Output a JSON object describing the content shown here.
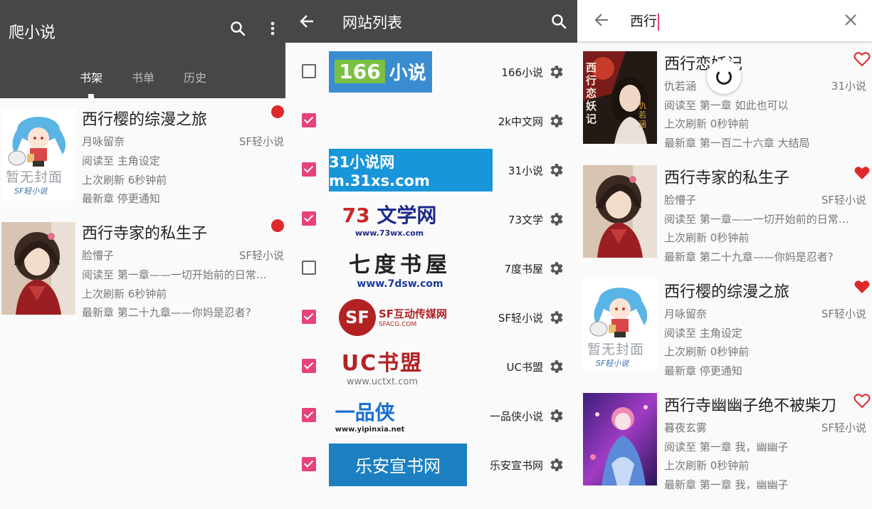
{
  "colors": {
    "appbar": "#474747",
    "accent": "#e8427a",
    "unread_dot": "#e0282a",
    "heart": "#e0282a"
  },
  "bookshelf": {
    "title": "爬小说",
    "tabs": [
      "书架",
      "书单",
      "历史"
    ],
    "active_tab": "书架",
    "books": [
      {
        "title": "西行樱的综漫之旅",
        "author": "月咏留奈",
        "source": "SF轻小说",
        "read_to": "阅读至  主角设定",
        "refresh": "上次刷新  6秒钟前",
        "latest": "最新章  停更通知",
        "cover_text": "暂无封面",
        "cover_brand": "SF轻小说"
      },
      {
        "title": "西行寺家的私生子",
        "author": "脸懵子",
        "source": "SF轻小说",
        "read_to": "阅读至  第一章——一切开始前的日常…",
        "refresh": "上次刷新  6秒钟前",
        "latest": "最新章  第二十九章——你妈是忍者?"
      }
    ]
  },
  "sites": {
    "title": "网站列表",
    "items": [
      {
        "name": "166小说",
        "checked": false,
        "logo": "166 小说"
      },
      {
        "name": "2k中文网",
        "checked": true,
        "logo": ""
      },
      {
        "name": "31小说",
        "checked": true,
        "logo": "31小说网 m.31xs.com"
      },
      {
        "name": "73文学",
        "checked": true,
        "logo": "73 文学网",
        "logo_sub": "www.73wx.com"
      },
      {
        "name": "7度书屋",
        "checked": false,
        "logo": "七度书屋",
        "logo_sub": "www.7dsw.com"
      },
      {
        "name": "SF轻小说",
        "checked": true,
        "logo": "SF互动传媒网",
        "logo_sub": "SFACG.COM"
      },
      {
        "name": "UC书盟",
        "checked": true,
        "logo": "UC书盟",
        "logo_sub": "www.uctxt.com"
      },
      {
        "name": "一品侠小说",
        "checked": true,
        "logo": "一品侠",
        "logo_sub": "www.yipinxia.net"
      },
      {
        "name": "乐安宣书网",
        "checked": true,
        "logo": "乐安宣书网"
      }
    ]
  },
  "search": {
    "query": "西行",
    "results": [
      {
        "title": "西行恋妖记",
        "author": "仇若涵",
        "source": "31小说",
        "read_to": "阅读至  第一章 如此也可以",
        "refresh": "上次刷新  0秒钟前",
        "latest": "最新章  第一百二十六章 大结局",
        "favorite": false,
        "cover_text": "西行恋妖记",
        "cover_author": "仇若涵"
      },
      {
        "title": "西行寺家的私生子",
        "author": "脸懵子",
        "source": "SF轻小说",
        "read_to": "阅读至  第一章——一切开始前的日常…",
        "refresh": "上次刷新  0秒钟前",
        "latest": "最新章  第二十九章——你妈是忍者?",
        "favorite": true
      },
      {
        "title": "西行樱的综漫之旅",
        "author": "月咏留奈",
        "source": "SF轻小说",
        "read_to": "阅读至  主角设定",
        "refresh": "上次刷新  0秒钟前",
        "latest": "最新章  停更通知",
        "favorite": true,
        "cover_text": "暂无封面",
        "cover_brand": "SF轻小说"
      },
      {
        "title": "西行寺幽幽子绝不被柴刀",
        "author": "暮夜玄雾",
        "source": "SF轻小说",
        "read_to": "阅读至  第一章 我，幽幽子",
        "refresh": "上次刷新  0秒钟前",
        "latest": "最新章  第一章 我，幽幽子",
        "favorite": false
      }
    ]
  }
}
